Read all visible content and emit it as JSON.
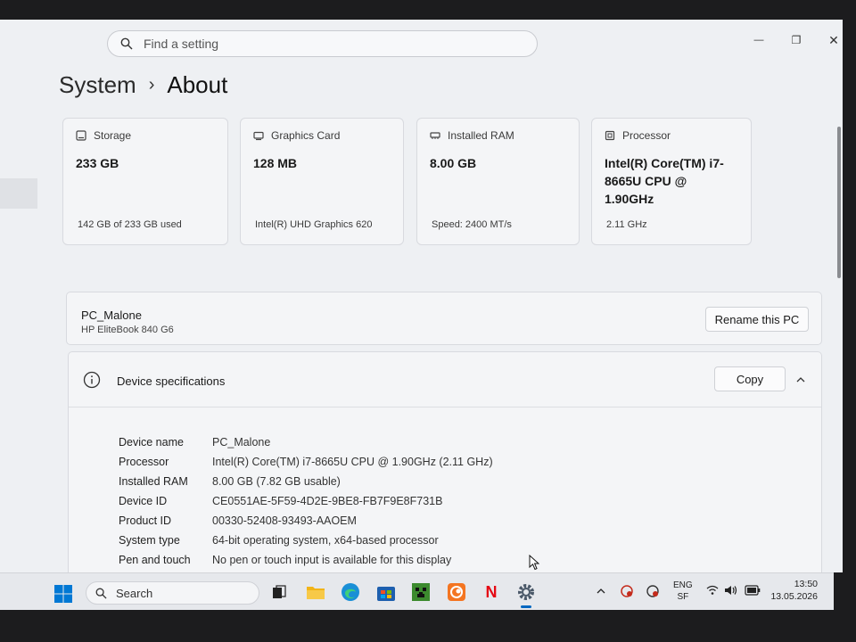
{
  "window": {
    "search_placeholder": "Find a setting",
    "minimize_glyph": "—",
    "restore_glyph": "❐",
    "close_glyph": "✕"
  },
  "breadcrumb": {
    "root": "System",
    "separator": "›",
    "current": "About"
  },
  "cards": [
    {
      "icon": "storage-icon",
      "title": "Storage",
      "value": "233 GB",
      "sub": "142 GB of 233 GB used"
    },
    {
      "icon": "graphics-card-icon",
      "title": "Graphics Card",
      "value": "128 MB",
      "sub": "Intel(R) UHD Graphics 620"
    },
    {
      "icon": "ram-icon",
      "title": "Installed RAM",
      "value": "8.00 GB",
      "sub": "Speed: 2400 MT/s"
    },
    {
      "icon": "processor-icon",
      "title": "Processor",
      "value": "Intel(R) Core(TM) i7-8665U CPU @ 1.90GHz",
      "sub": "2.11 GHz"
    }
  ],
  "pc": {
    "name": "PC_Malone",
    "model": "HP EliteBook 840 G6",
    "rename_label": "Rename this PC"
  },
  "specs": {
    "title": "Device specifications",
    "copy_label": "Copy",
    "rows": [
      {
        "label": "Device name",
        "value": "PC_Malone"
      },
      {
        "label": "Processor",
        "value": "Intel(R) Core(TM) i7-8665U CPU @ 1.90GHz (2.11 GHz)"
      },
      {
        "label": "Installed RAM",
        "value": "8.00 GB (7.82 GB usable)"
      },
      {
        "label": "Device ID",
        "value": "CE0551AE-5F59-4D2E-9BE8-FB7F9E8F731B"
      },
      {
        "label": "Product ID",
        "value": "00330-52408-93493-AAOEM"
      },
      {
        "label": "System type",
        "value": "64-bit operating system, x64-based processor"
      },
      {
        "label": "Pen and touch",
        "value": "No pen or touch input is available for this display"
      }
    ]
  },
  "taskbar": {
    "search_label": "Search",
    "apps": [
      "task-view",
      "file-explorer",
      "edge",
      "microsoft-store",
      "minecraft",
      "crunchyroll",
      "netflix",
      "settings"
    ],
    "netflix_glyph": "N",
    "lang_top": "ENG",
    "lang_bottom": "SF",
    "time": "13:50",
    "date": "13.05.2026"
  },
  "colors": {
    "accent": "#0067c0",
    "edge": "#1a8fd6",
    "store": "#1e5fae",
    "minecraft": "#3c8a2e",
    "crunchyroll": "#f47521",
    "netflix": "#e50914",
    "explorer": "#f2b418"
  }
}
